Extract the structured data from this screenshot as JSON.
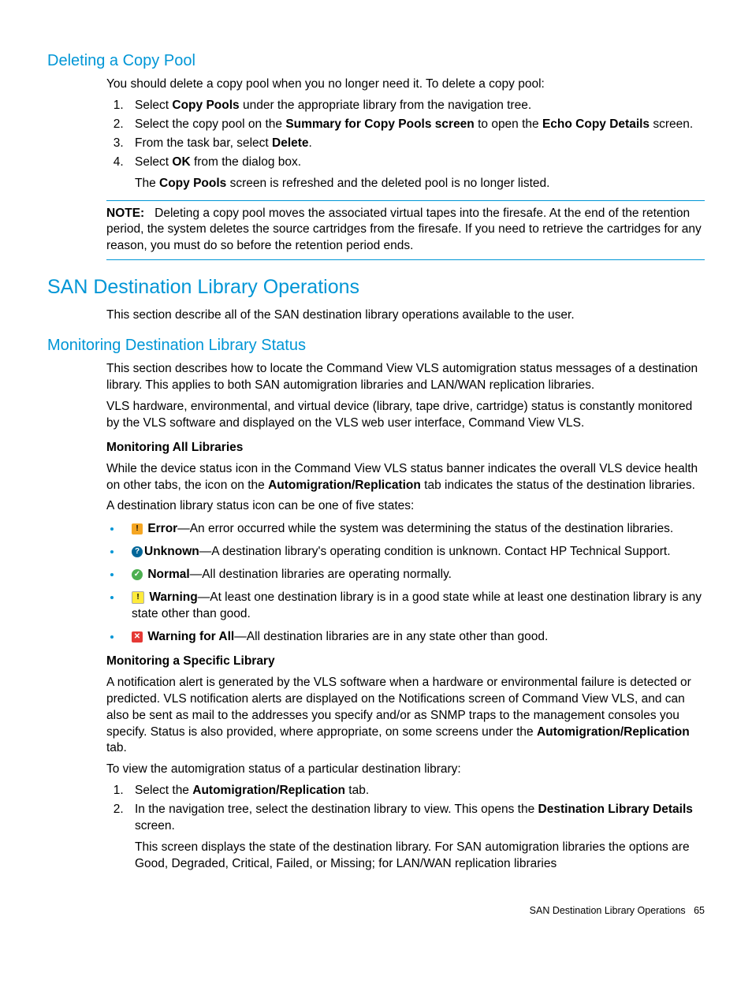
{
  "h_delete": "Deleting a Copy Pool",
  "delete": {
    "intro": "You should delete a copy pool when you no longer need it. To delete a copy pool:",
    "step1_a": "Select ",
    "step1_b": "Copy Pools",
    "step1_c": " under the appropriate library from the navigation tree.",
    "step2_a": "Select the copy pool on the ",
    "step2_b": "Summary for Copy Pools screen",
    "step2_c": " to open the ",
    "step2_d": "Echo Copy Details",
    "step2_e": " screen.",
    "step3_a": "From the task bar, select ",
    "step3_b": "Delete",
    "step3_c": ".",
    "step4_a": "Select ",
    "step4_b": "OK",
    "step4_c": " from the dialog box.",
    "result_a": "The ",
    "result_b": "Copy Pools",
    "result_c": " screen is refreshed and the deleted pool is no longer listed.",
    "note_label": "NOTE:",
    "note_text": "Deleting a copy pool moves the associated virtual tapes into the firesafe. At the end of the retention period, the system deletes the source cartridges from the firesafe. If you need to retrieve the cartridges for any reason, you must do so before the retention period ends."
  },
  "h_san": "SAN Destination Library Operations",
  "san_intro": "This section describe all of the SAN destination library operations available to the user.",
  "h_monitor": "Monitoring Destination Library Status",
  "mon": {
    "p1": "This section describes how to locate the Command View VLS automigration status messages of a destination library. This applies to both SAN automigration libraries and LAN/WAN replication libraries.",
    "p2": "VLS hardware, environmental, and virtual device (library, tape drive, cartridge) status is constantly monitored by the VLS software and displayed on the VLS web user interface, Command View VLS.",
    "sub_all": "Monitoring All Libraries",
    "p3_a": "While the device status icon in the Command View VLS status banner indicates the overall VLS device health on other tabs, the icon on the ",
    "p3_b": "Automigration/Replication",
    "p3_c": " tab indicates the status of the destination libraries.",
    "p4": "A destination library status icon can be one of five states:",
    "s_error_b": "Error",
    "s_error_t": "—An error occurred while the system was determining the status of the destination libraries.",
    "s_unknown_b": "Unknown",
    "s_unknown_t": "—A destination library's operating condition is unknown. Contact HP Technical Support.",
    "s_normal_b": "Normal",
    "s_normal_t": "—All destination libraries are operating normally.",
    "s_warning_b": "Warning",
    "s_warning_t": "—At least one destination library is in a good state while at least one destination library is any state other than good.",
    "s_warnall_b": "Warning for All",
    "s_warnall_t": "—All destination libraries are in any state other than good.",
    "sub_spec": "Monitoring a Specific Library",
    "p5_a": "A notification alert is generated by the VLS software when a hardware or environmental failure is detected or predicted. VLS notification alerts are displayed on the Notifications screen of Command View VLS, and can also be sent as mail to the addresses you specify and/or as SNMP traps to the management consoles you specify. Status is also provided, where appropriate, on some screens under the ",
    "p5_b": "Automigration/Replication",
    "p5_c": " tab.",
    "p6": "To view the automigration status of a particular destination library:",
    "step1_a": "Select the ",
    "step1_b": "Automigration/Replication",
    "step1_c": " tab.",
    "step2_a": "In the navigation tree, select the destination library to view. This opens the ",
    "step2_b": "Destination Library Details",
    "step2_c": " screen.",
    "step2_sub": "This screen displays the state of the destination library. For SAN automigration libraries the options are Good, Degraded, Critical, Failed, or Missing; for LAN/WAN replication libraries"
  },
  "footer_text": "SAN Destination Library Operations",
  "footer_page": "65"
}
